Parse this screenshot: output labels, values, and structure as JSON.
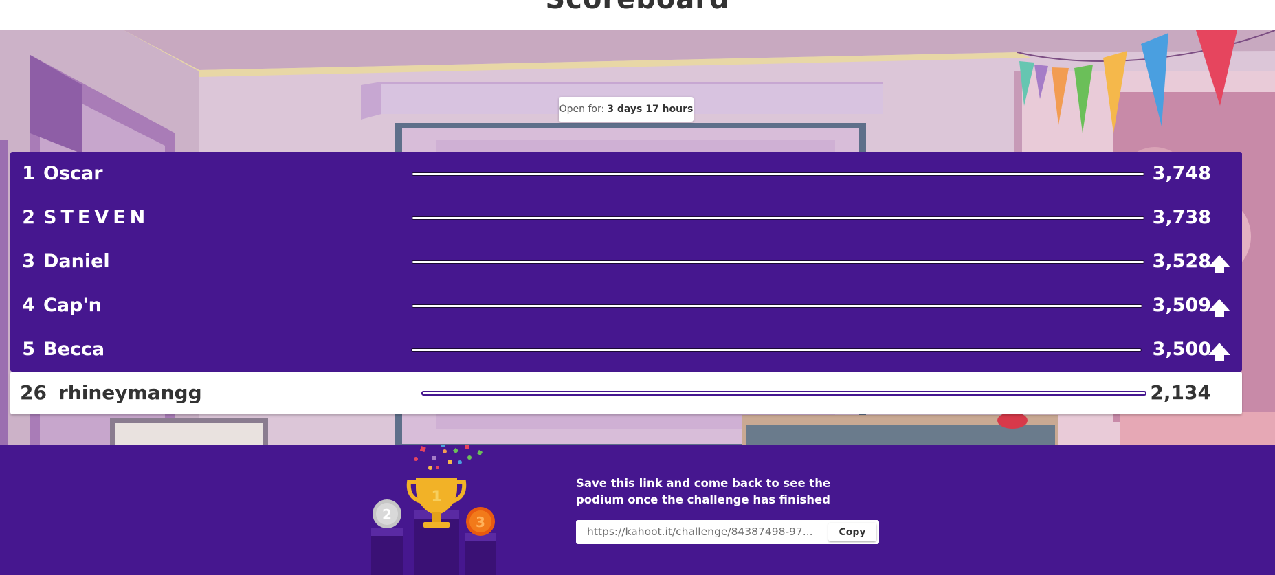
{
  "header": {
    "title": "Scoreboard"
  },
  "badge": {
    "label": "Open for:",
    "value": "3 days 17 hours"
  },
  "leaderboard": [
    {
      "rank": "1",
      "name": "Oscar",
      "score": "3,748",
      "trend": ""
    },
    {
      "rank": "2",
      "name": "STEVEN",
      "score": "3,738",
      "trend": ""
    },
    {
      "rank": "3",
      "name": "Daniel",
      "score": "3,528",
      "trend": "up"
    },
    {
      "rank": "4",
      "name": "Cap'n",
      "score": "3,509",
      "trend": "up"
    },
    {
      "rank": "5",
      "name": "Becca",
      "score": "3,500",
      "trend": "up"
    }
  ],
  "current_player": {
    "rank": "26",
    "name": "rhineymangg",
    "score": "2,134"
  },
  "footer": {
    "message": "Save this link and come back to see the podium once the challenge has finished",
    "link_value": "https://kahoot.it/challenge/84387498-97...",
    "copy_label": "Copy"
  },
  "colors": {
    "brand_purple": "#46178f",
    "white": "#ffffff",
    "text_dark": "#333333",
    "trophy_gold": "#f2b227"
  },
  "icons": [
    "trend-up-arrow-icon",
    "trophy-icon",
    "confetti-icon",
    "silver-medal-icon",
    "bronze-medal-icon"
  ]
}
